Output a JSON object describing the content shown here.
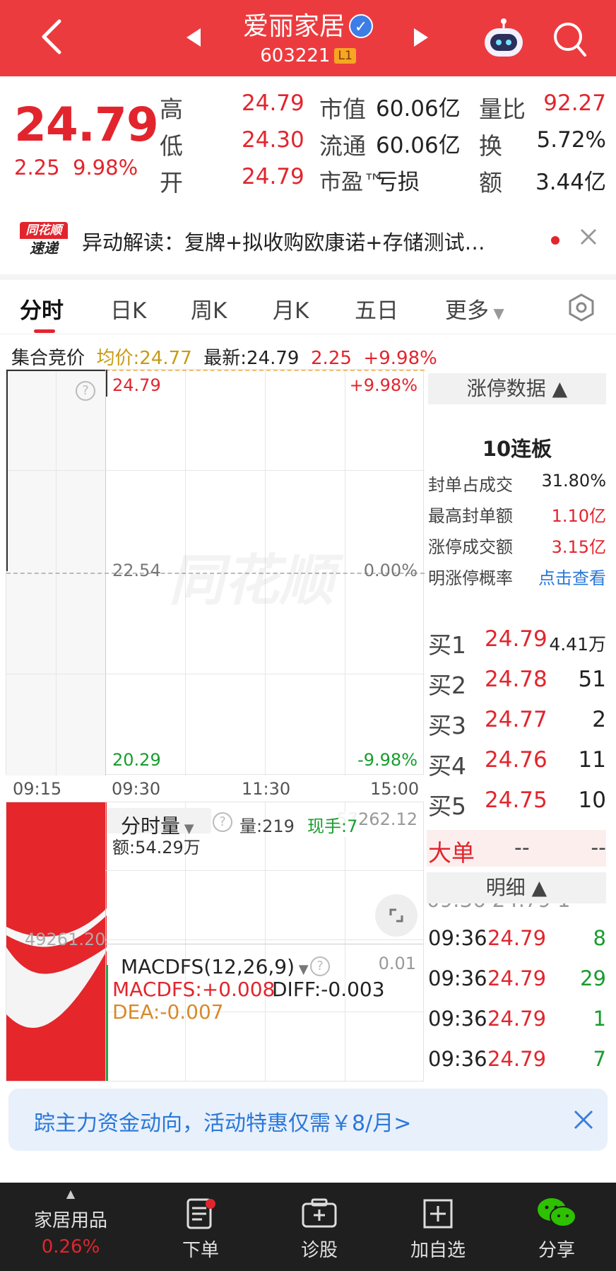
{
  "header": {
    "title": "爱丽家居",
    "code": "603221",
    "level": "L1"
  },
  "quote": {
    "price": "24.79",
    "change": "2.25",
    "change_pct": "9.98%",
    "rows": [
      {
        "l1": "高",
        "v1": "24.79",
        "l2": "市值",
        "v2": "60.06亿",
        "l3": "量比",
        "v3": "92.27"
      },
      {
        "l1": "低",
        "v1": "24.30",
        "l2": "流通",
        "v2": "60.06亿",
        "l3": "换",
        "v3": "5.72%"
      },
      {
        "l1": "开",
        "v1": "24.79",
        "l2": "市盈™",
        "v2": "亏损",
        "l3": "额",
        "v3": "3.44亿"
      }
    ]
  },
  "news": {
    "logo_line1": "同花顺",
    "logo_line2": "速递",
    "text": "异动解读：复牌+拟收购欧康诺+存储测试…"
  },
  "tabs": [
    "分时",
    "日K",
    "周K",
    "月K",
    "五日",
    "更多"
  ],
  "info_bar": {
    "auction": "集合竞价",
    "avg": "均价:24.77",
    "latest": "最新:24.79",
    "chg": "2.25",
    "pct": "+9.98%"
  },
  "price_chart": {
    "top_price": "24.79",
    "top_pct": "+9.98%",
    "mid_price": "22.54",
    "mid_pct": "0.00%",
    "bot_price": "20.29",
    "bot_pct": "-9.98%",
    "watermark": "同花顺",
    "times": [
      "09:15",
      "09:30",
      "11:30",
      "15:00"
    ]
  },
  "volume_chart": {
    "selector": "分时量",
    "vol": "量:219",
    "hand": "现手:7",
    "right_val": "57262.12",
    "amount": "额:54.29万",
    "left_val": "49261.20"
  },
  "macd": {
    "selector": "MACDFS(12,26,9)",
    "right_val": "0.01",
    "macd": "MACDFS:+0.008",
    "diff": "DIFF:-0.003",
    "dea": "DEA:-0.007"
  },
  "limit_panel": {
    "header": "涨停数据 ▲",
    "streak": "10连板",
    "rows": [
      {
        "label": "封单占成交",
        "value": "31.80%"
      },
      {
        "label": "最高封单额",
        "value": "1.10亿"
      },
      {
        "label": "涨停成交额",
        "value": "3.15亿"
      },
      {
        "label": "明涨停概率",
        "value": "点击查看"
      }
    ]
  },
  "order_book": [
    {
      "label": "买1",
      "price": "24.79",
      "vol": "4.41万"
    },
    {
      "label": "买2",
      "price": "24.78",
      "vol": "51"
    },
    {
      "label": "买3",
      "price": "24.77",
      "vol": "2"
    },
    {
      "label": "买4",
      "price": "24.76",
      "vol": "11"
    },
    {
      "label": "买5",
      "price": "24.75",
      "vol": "10"
    }
  ],
  "big_order": {
    "label": "大单",
    "v1": "--",
    "v2": "--"
  },
  "detail": {
    "header": "明细 ▲",
    "rows": [
      {
        "time": "09:36",
        "price": "24.79",
        "vol": "8"
      },
      {
        "time": "09:36",
        "price": "24.79",
        "vol": "29"
      },
      {
        "time": "09:36",
        "price": "24.79",
        "vol": "1"
      },
      {
        "time": "09:36",
        "price": "24.79",
        "vol": "7"
      }
    ]
  },
  "promo": {
    "text": "踪主力资金动向，活动特惠仅需￥8/月>"
  },
  "bottom_nav": [
    {
      "label": "家居用品",
      "sub": "0.26%"
    },
    {
      "label": "下单"
    },
    {
      "label": "诊股"
    },
    {
      "label": "加自选"
    },
    {
      "label": "分享"
    }
  ],
  "colors": {
    "brand_red": "#ec3b3f",
    "up": "#e2252d",
    "down": "#199c2e"
  }
}
